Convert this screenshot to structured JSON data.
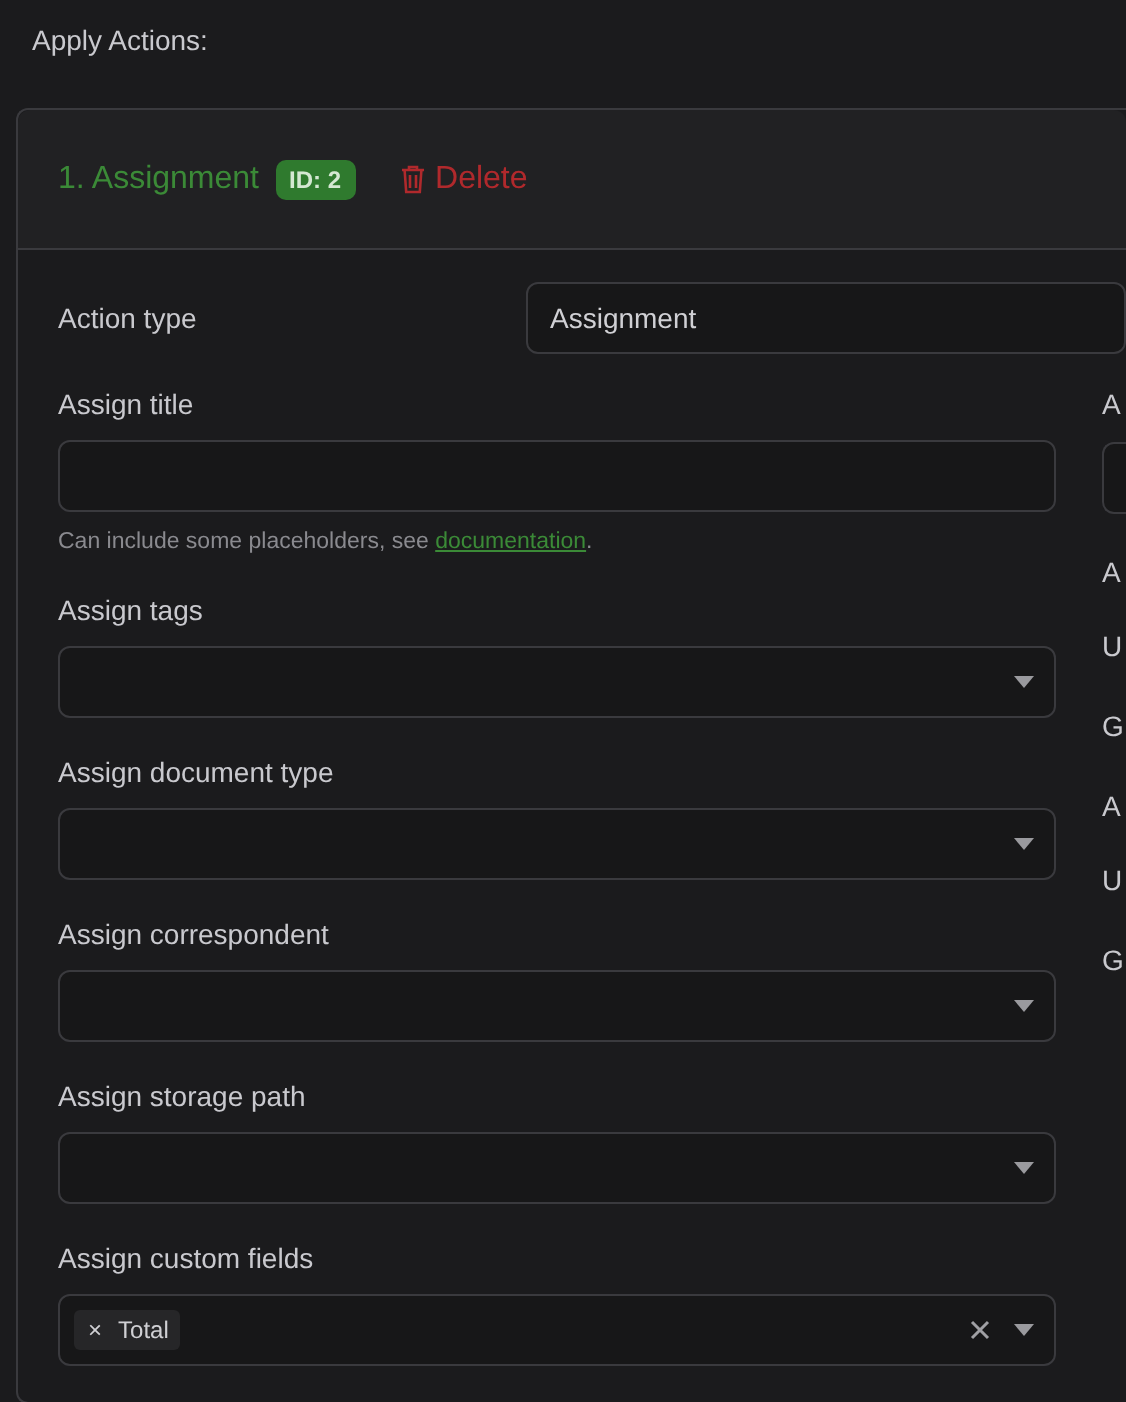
{
  "section_title": "Apply Actions:",
  "action": {
    "title": "1. Assignment",
    "id_badge": "ID: 2",
    "delete_label": "Delete",
    "action_type": {
      "label": "Action type",
      "value": "Assignment"
    },
    "left_fields": [
      {
        "label": "Assign title",
        "kind": "text",
        "hint": "Can include some placeholders, see ",
        "hint_link": "documentation",
        "hint_end": "."
      },
      {
        "label": "Assign tags",
        "kind": "select"
      },
      {
        "label": "Assign document type",
        "kind": "select"
      },
      {
        "label": "Assign correspondent",
        "kind": "select"
      },
      {
        "label": "Assign storage path",
        "kind": "select"
      },
      {
        "label": "Assign custom fields",
        "kind": "multiselect",
        "chips": [
          {
            "remove": "×",
            "label": "Total"
          }
        ]
      }
    ],
    "right_items": [
      {
        "kind": "label",
        "text": "A"
      },
      {
        "kind": "field"
      },
      {
        "kind": "label",
        "text": "A"
      },
      {
        "kind": "option",
        "text": "U"
      },
      {
        "kind": "option",
        "text": "G"
      },
      {
        "kind": "label",
        "text": "A"
      },
      {
        "kind": "option",
        "text": "U"
      },
      {
        "kind": "option",
        "text": "G"
      }
    ]
  }
}
